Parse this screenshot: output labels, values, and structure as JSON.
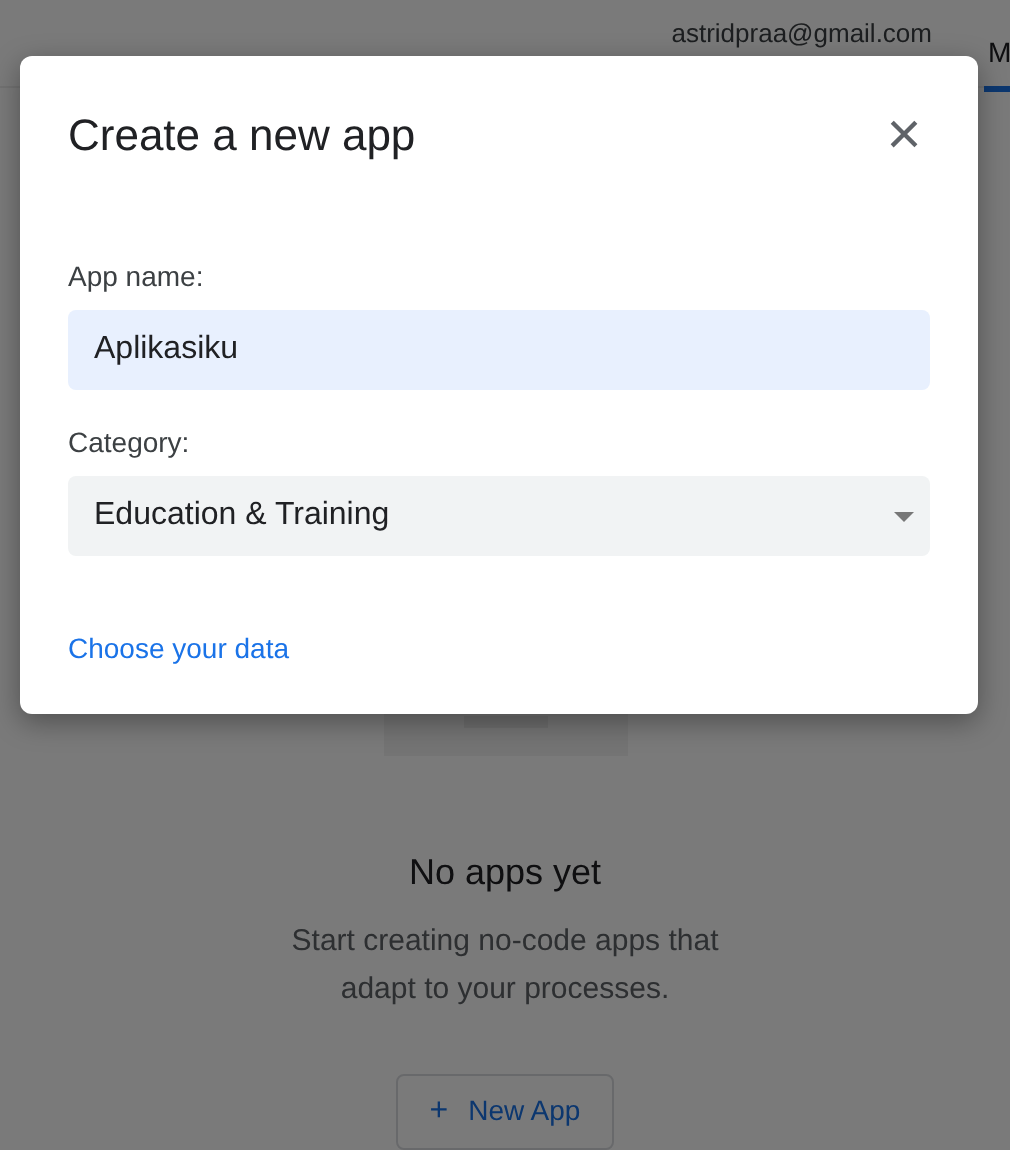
{
  "header": {
    "account": "astridpraa@gmail.com",
    "tabs": [
      {
        "label": "M",
        "selected": true
      }
    ]
  },
  "empty_state": {
    "title": "No apps yet",
    "description": "Start creating no-code apps that adapt to your processes.",
    "button": {
      "icon": "+",
      "label": "New App"
    }
  },
  "dialog": {
    "title": "Create a new app",
    "close": "×",
    "fields": [
      {
        "kind": "text",
        "label": "App name:",
        "value": "Aplikasiku"
      },
      {
        "kind": "select",
        "label": "Category:",
        "value": "Education & Training"
      }
    ],
    "link": "Choose your data"
  }
}
